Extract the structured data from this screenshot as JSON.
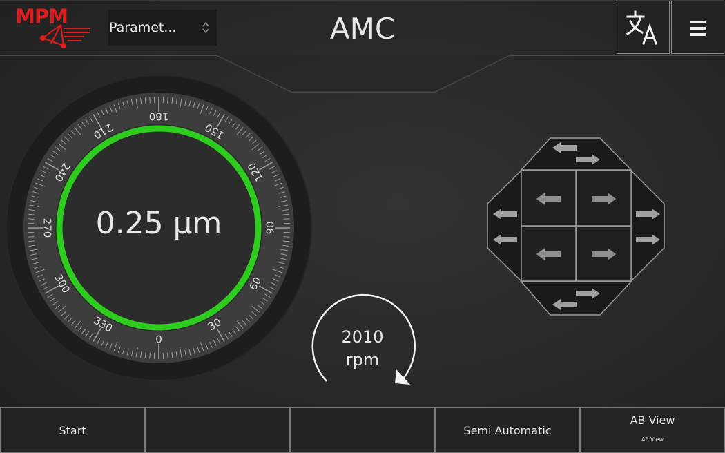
{
  "header": {
    "logo_text": "MPM",
    "select_value": "Paramet...",
    "title": "AMC",
    "language_icon": "translate-icon",
    "menu_icon": "hamburger-menu-icon"
  },
  "dial": {
    "reading": "0.25 µm",
    "scale_labels": [
      "0",
      "30",
      "60",
      "90",
      "120",
      "150",
      "180",
      "210",
      "240",
      "270",
      "300",
      "330"
    ],
    "ring_color": "#2ecc1f"
  },
  "speed": {
    "value": "2010",
    "unit": "rpm"
  },
  "jog": {
    "icons": [
      "arrow-left-icon",
      "arrow-right-icon"
    ]
  },
  "bottom": {
    "start_label": "Start",
    "btn2_label": "",
    "btn3_label": "",
    "mode_label": "Semi Automatic",
    "view_label": "AB View",
    "view_sub_label": "AE View"
  }
}
